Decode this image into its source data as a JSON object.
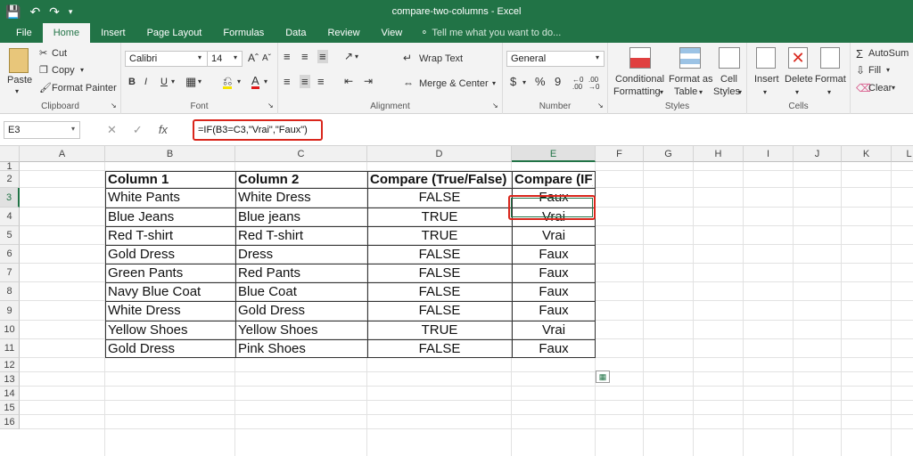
{
  "window": {
    "title": "compare-two-columns - Excel"
  },
  "tabs": [
    "File",
    "Home",
    "Insert",
    "Page Layout",
    "Formulas",
    "Data",
    "Review",
    "View"
  ],
  "tell_me": "Tell me what you want to do...",
  "ribbon": {
    "clipboard": {
      "paste": "Paste",
      "cut": "Cut",
      "copy": "Copy",
      "format_painter": "Format Painter",
      "label": "Clipboard"
    },
    "font": {
      "name": "Calibri",
      "size": "14",
      "bold": "B",
      "italic": "I",
      "underline": "U",
      "label": "Font"
    },
    "alignment": {
      "wrap_text": "Wrap Text",
      "merge_center": "Merge & Center",
      "label": "Alignment"
    },
    "number": {
      "format": "General",
      "currency": "$",
      "percent": "%",
      "comma": "9",
      "label": "Number"
    },
    "styles": {
      "conditional": "Conditional",
      "formatting": "Formatting",
      "format_as": "Format as",
      "table": "Table",
      "cell": "Cell",
      "cell_styles": "Styles",
      "label": "Styles"
    },
    "cells": {
      "insert": "Insert",
      "delete": "Delete",
      "format": "Format",
      "label": "Cells"
    },
    "editing": {
      "autosum": "AutoSum",
      "fill": "Fill",
      "clear": "Clear"
    }
  },
  "formula_bar": {
    "name_box": "E3",
    "fx": "fx",
    "formula": "=IF(B3=C3,\"Vrai\",\"Faux\")"
  },
  "columns": [
    "A",
    "B",
    "C",
    "D",
    "E",
    "F",
    "G",
    "H",
    "I",
    "J",
    "K",
    "L"
  ],
  "rows": [
    "1",
    "2",
    "3",
    "4",
    "5",
    "6",
    "7",
    "8",
    "9",
    "10",
    "11",
    "12",
    "13",
    "14",
    "15",
    "16"
  ],
  "table": {
    "headers": [
      "Column 1",
      "Column 2",
      "Compare  (True/False)",
      "Compare (IF)"
    ],
    "rows": [
      [
        "White Pants",
        "White Dress",
        "FALSE",
        "Faux"
      ],
      [
        "Blue Jeans",
        "Blue jeans",
        "TRUE",
        "Vrai"
      ],
      [
        "Red T-shirt",
        "Red T-shirt",
        "TRUE",
        "Vrai"
      ],
      [
        "Gold Dress",
        "Dress",
        "FALSE",
        "Faux"
      ],
      [
        "Green Pants",
        "Red Pants",
        "FALSE",
        "Faux"
      ],
      [
        "Navy Blue Coat",
        "Blue Coat",
        "FALSE",
        "Faux"
      ],
      [
        "White Dress",
        "Gold Dress",
        "FALSE",
        "Faux"
      ],
      [
        "Yellow Shoes",
        "Yellow Shoes",
        "TRUE",
        "Vrai"
      ],
      [
        "Gold Dress",
        "Pink Shoes",
        "FALSE",
        "Faux"
      ]
    ]
  },
  "colors": {
    "excel_green": "#217346",
    "highlight_red": "#d9261c"
  }
}
